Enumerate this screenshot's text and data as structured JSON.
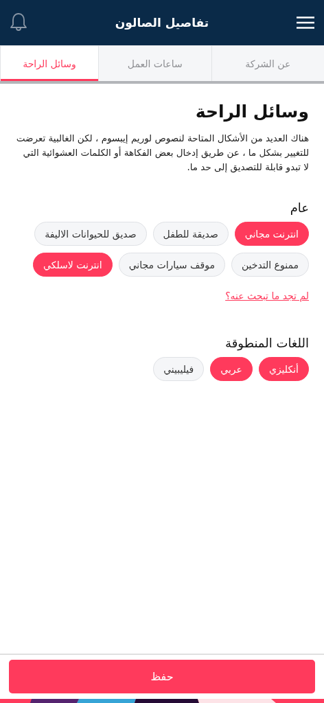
{
  "header": {
    "title": "تفاصيل الصالون"
  },
  "tabs": [
    {
      "label": "عن الشركة",
      "selected": false
    },
    {
      "label": "ساعات العمل",
      "selected": false
    },
    {
      "label": "وسائل الراحة",
      "selected": true
    }
  ],
  "section": {
    "title": "وسائل الراحة",
    "description": "هناك العديد من الأشكال المتاحة لنصوص لوريم إيبسوم ، لكن الغالبية تعرضت للتغيير بشكل ما ، عن طريق إدخال بعض الفكاهة أو الكلمات العشوائية التي لا تبدو قابلة للتصديق إلى حد ما."
  },
  "groups": [
    {
      "title": "عام",
      "chips": [
        {
          "label": "انترنت مجاني",
          "selected": true
        },
        {
          "label": "صديقة للطفل",
          "selected": false
        },
        {
          "label": "صديق للحيوانات الاليفة",
          "selected": false
        },
        {
          "label": "ممنوع التدخين",
          "selected": false
        },
        {
          "label": "موقف سيارات مجاني",
          "selected": false
        },
        {
          "label": "انترنت لاسلكي",
          "selected": true
        }
      ],
      "link": "لم تجد ما تبحث عنه؟"
    },
    {
      "title": "اللغات المنطوقة",
      "chips": [
        {
          "label": "أنكليزي",
          "selected": true
        },
        {
          "label": "عربي",
          "selected": true
        },
        {
          "label": "فيليبيني",
          "selected": false
        }
      ]
    }
  ],
  "save_button": "حفظ"
}
